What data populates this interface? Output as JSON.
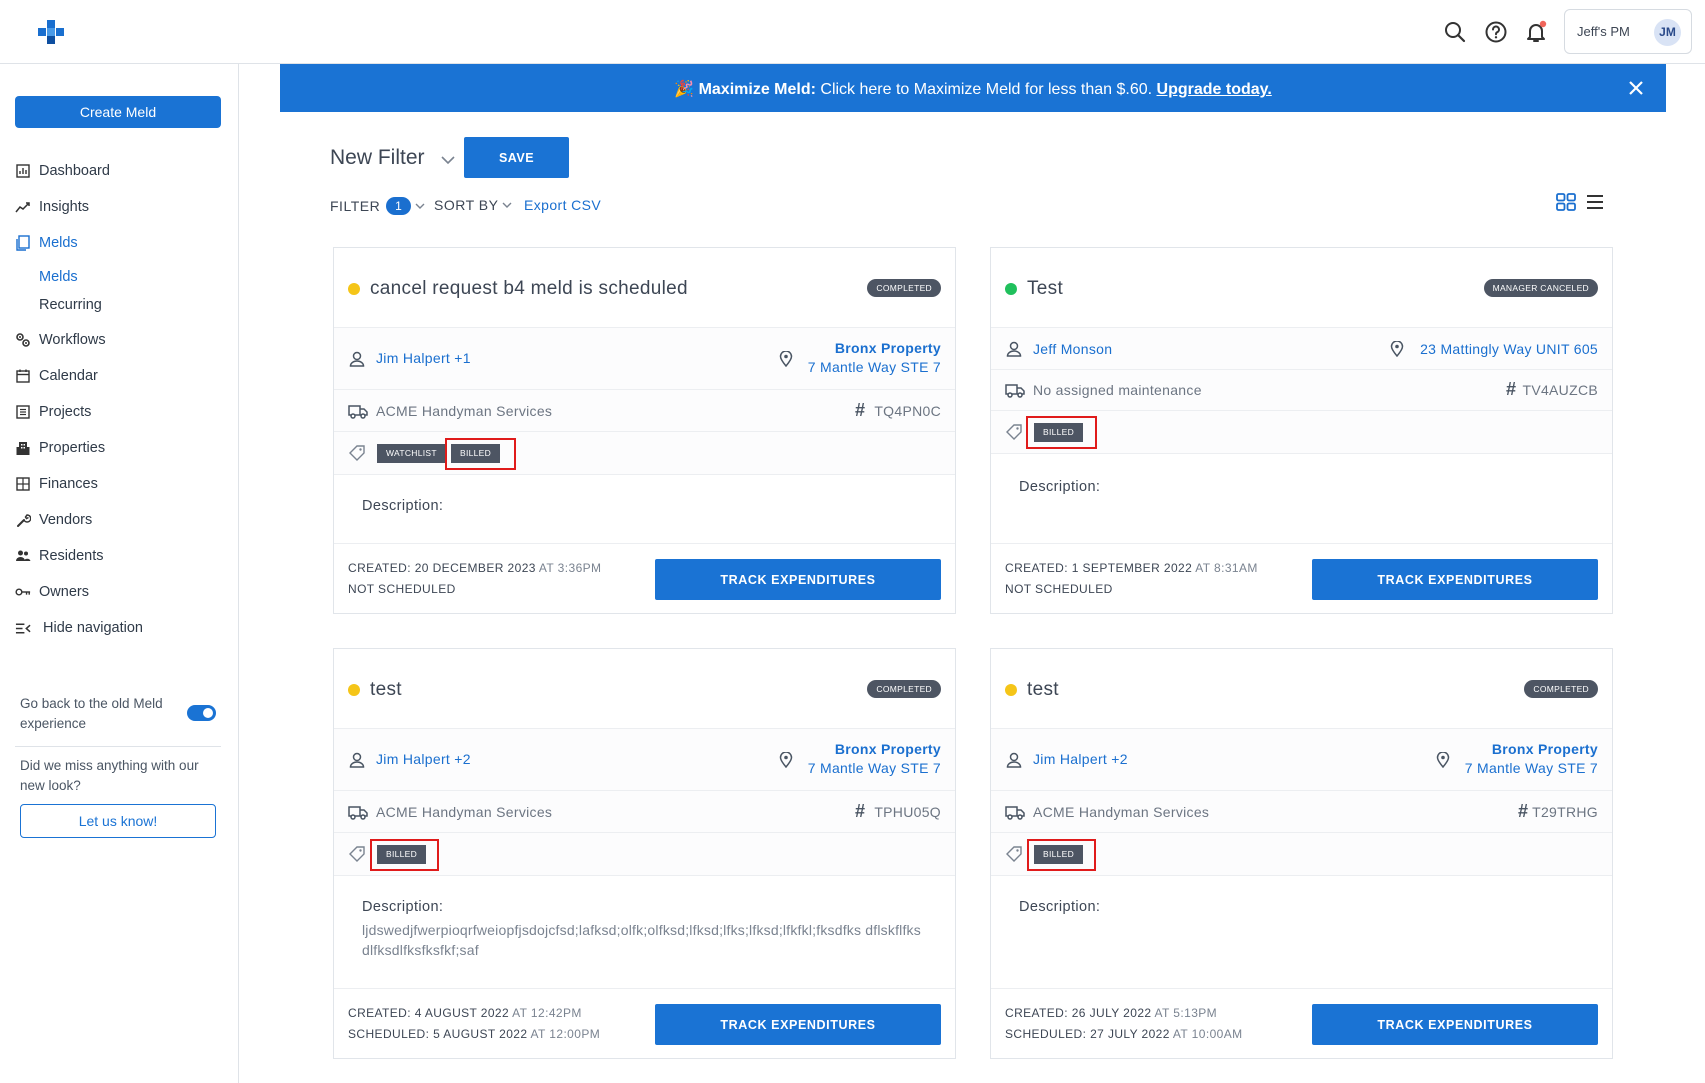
{
  "header": {
    "account_name": "Jeff's PM",
    "avatar_initials": "JM"
  },
  "sidebar": {
    "create_label": "Create Meld",
    "items": [
      {
        "label": "Dashboard",
        "icon": "dashboard-icon"
      },
      {
        "label": "Insights",
        "icon": "insights-icon"
      },
      {
        "label": "Melds",
        "icon": "melds-icon",
        "active": true
      },
      {
        "label": "Workflows",
        "icon": "workflows-icon"
      },
      {
        "label": "Calendar",
        "icon": "calendar-icon"
      },
      {
        "label": "Projects",
        "icon": "projects-icon"
      },
      {
        "label": "Properties",
        "icon": "properties-icon"
      },
      {
        "label": "Finances",
        "icon": "finances-icon"
      },
      {
        "label": "Vendors",
        "icon": "vendors-icon"
      },
      {
        "label": "Residents",
        "icon": "residents-icon"
      },
      {
        "label": "Owners",
        "icon": "owners-icon"
      },
      {
        "label": "Hide navigation",
        "icon": "hide-navigation-icon"
      }
    ],
    "subitems": [
      "Melds",
      "Recurring"
    ],
    "old_experience_text": "Go back to the old Meld experience",
    "miss_text": "Did we miss anything with our new look?",
    "let_us_know": "Let us know!"
  },
  "banner": {
    "emoji": "🎉",
    "bold": "Maximize Meld:",
    "text": " Click here to Maximize Meld for less than $.60. ",
    "link": "Upgrade today."
  },
  "filter": {
    "title": "New Filter",
    "save_label": "SAVE",
    "filter_label": "FILTER",
    "filter_count": "1",
    "sort_label": "SORT BY",
    "export_label": "Export CSV"
  },
  "colors": {
    "accent": "#1a73d4",
    "status_yellow": "#f5c518",
    "status_green": "#20c05c",
    "highlight": "#e01b1b"
  },
  "cards": [
    {
      "title": "cancel request b4 meld is scheduled",
      "status": "COMPLETED",
      "assignee": "Jim Halpert +1",
      "property": "Bronx Property",
      "address": "7 Mantle Way STE 7",
      "vendor": "ACME Handyman Services",
      "code": "TQ4PN0C",
      "tags": [
        "WATCHLIST",
        "BILLED"
      ],
      "description_label": "Description:",
      "description": "",
      "created_label": "CREATED: 20 DECEMBER 2023",
      "created_time": "AT 3:36PM",
      "scheduled_label": "NOT SCHEDULED",
      "scheduled_time": "",
      "track_label": "TRACK EXPENDITURES"
    },
    {
      "title": "Test",
      "status": "MANAGER CANCELED",
      "assignee": "Jeff Monson",
      "property": "",
      "address": "23 Mattingly Way UNIT 605",
      "vendor": "No assigned maintenance",
      "code": "TV4AUZCB",
      "tags": [
        "BILLED"
      ],
      "description_label": "Description:",
      "description": "",
      "created_label": "CREATED: 1 SEPTEMBER 2022",
      "created_time": "AT 8:31AM",
      "scheduled_label": "NOT SCHEDULED",
      "scheduled_time": "",
      "track_label": "TRACK EXPENDITURES"
    },
    {
      "title": "test",
      "status": "COMPLETED",
      "assignee": "Jim Halpert +2",
      "property": "Bronx Property",
      "address": "7 Mantle Way STE 7",
      "vendor": "ACME Handyman Services",
      "code": "TPHU05Q",
      "tags": [
        "BILLED"
      ],
      "description_label": "Description:",
      "description": "ljdswedjfwerpioqrfweiopfjsdojcfsd;lafksd;olfk;olfksd;lfksd;lfks;lfksd;lfkfkl;fksdfks dflskflfksdlfksdlfksfksfkf;saf",
      "created_label": "CREATED: 4 AUGUST 2022",
      "created_time": "AT 12:42PM",
      "scheduled_label": "SCHEDULED: 5 AUGUST 2022",
      "scheduled_time": "AT 12:00PM",
      "track_label": "TRACK EXPENDITURES"
    },
    {
      "title": "test",
      "status": "COMPLETED",
      "assignee": "Jim Halpert +2",
      "property": "Bronx Property",
      "address": "7 Mantle Way STE 7",
      "vendor": "ACME Handyman Services",
      "code": "T29TRHG",
      "tags": [
        "BILLED"
      ],
      "description_label": "Description:",
      "description": "",
      "created_label": "CREATED: 26 JULY 2022",
      "created_time": "AT 5:13PM",
      "scheduled_label": "SCHEDULED: 27 JULY 2022",
      "scheduled_time": "AT 10:00AM",
      "track_label": "TRACK EXPENDITURES"
    }
  ]
}
